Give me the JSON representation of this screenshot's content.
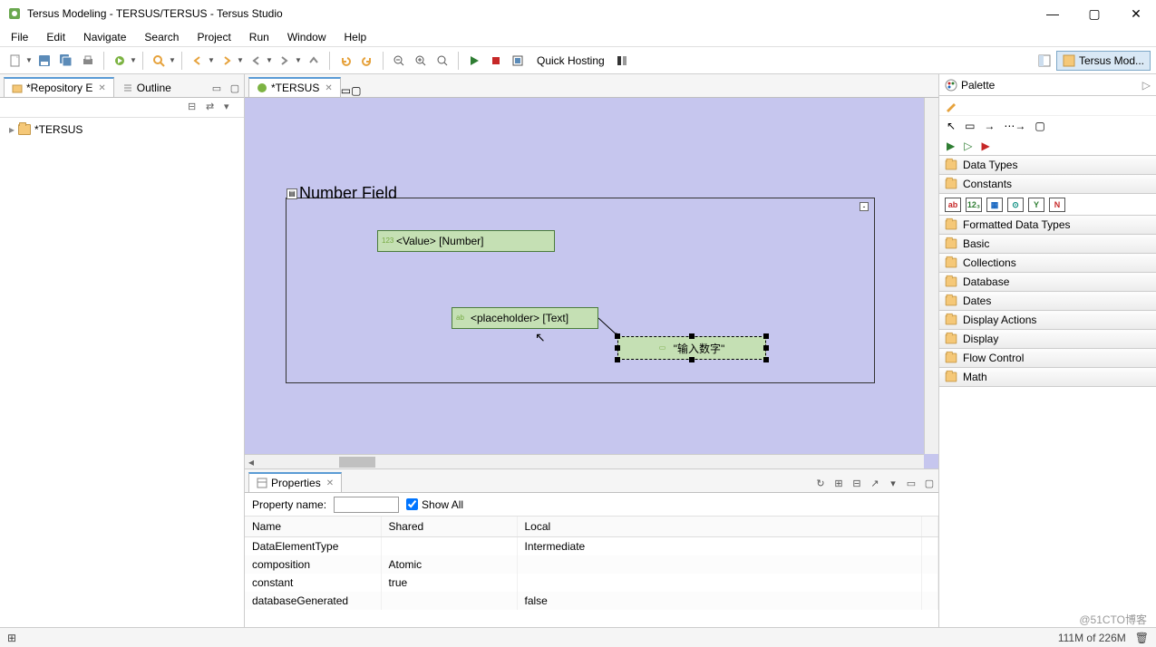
{
  "window": {
    "title": "Tersus Modeling - TERSUS/TERSUS - Tersus Studio",
    "min": "—",
    "max": "▢",
    "close": "✕"
  },
  "menu": [
    "File",
    "Edit",
    "Navigate",
    "Search",
    "Project",
    "Run",
    "Window",
    "Help"
  ],
  "toolbar": {
    "quick_hosting": "Quick Hosting"
  },
  "perspective": {
    "label": "Tersus Mod..."
  },
  "left": {
    "tab_repo": "*Repository E",
    "tab_outline": "Outline",
    "tree_root": "*TERSUS"
  },
  "editor": {
    "tab": "*TERSUS"
  },
  "canvas": {
    "box_title": "Number Field",
    "node_value": "<Value> [Number]",
    "node_placeholder": "<placeholder> [Text]",
    "node_text": "\"输入数字\""
  },
  "palette": {
    "title": "Palette",
    "cats": [
      "Data Types",
      "Constants",
      "Formatted Data Types",
      "Basic",
      "Collections",
      "Database",
      "Dates",
      "Display Actions",
      "Display",
      "Flow Control",
      "Math"
    ]
  },
  "properties": {
    "tab": "Properties",
    "name_label": "Property name:",
    "show_all": "Show All",
    "cols": [
      "Name",
      "Shared",
      "Local"
    ],
    "rows": [
      {
        "n": "DataElementType",
        "s": "",
        "l": "Intermediate"
      },
      {
        "n": "composition",
        "s": "Atomic",
        "l": ""
      },
      {
        "n": "constant",
        "s": "true",
        "l": ""
      },
      {
        "n": "databaseGenerated",
        "s": "",
        "l": "false"
      }
    ]
  },
  "status": {
    "mem": "111M of 226M"
  },
  "watermark": "@51CTO博客"
}
